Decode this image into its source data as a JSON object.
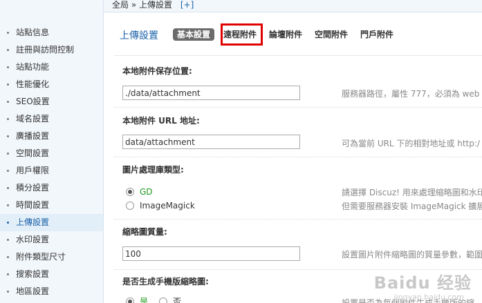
{
  "breadcrumb": {
    "home": "全局",
    "separator": "»",
    "current": "上傳設置",
    "add": "[+]"
  },
  "sidebar": {
    "items": [
      {
        "label": "站點信息"
      },
      {
        "label": "註冊與訪問控制"
      },
      {
        "label": "站點功能"
      },
      {
        "label": "性能優化"
      },
      {
        "label": "SEO設置"
      },
      {
        "label": "域名設置"
      },
      {
        "label": "廣播設置"
      },
      {
        "label": "空間設置"
      },
      {
        "label": "用戶權限"
      },
      {
        "label": "積分設置"
      },
      {
        "label": "時間設置"
      },
      {
        "label": "上傳設置",
        "active": true
      },
      {
        "label": "水印設置"
      },
      {
        "label": "附件類型尺寸"
      },
      {
        "label": "搜索設置"
      },
      {
        "label": "地區設置"
      }
    ]
  },
  "page": {
    "title": "上傳設置",
    "tabs": [
      "基本設置",
      "遠程附件",
      "論壇附件",
      "空間附件",
      "門戶附件"
    ],
    "active_tab": 0,
    "highlighted_tab": 1
  },
  "form": {
    "local_path": {
      "label": "本地附件保存位置:",
      "value": "./data/attachment",
      "tip": "服務器路徑，屬性 777，必須為 web"
    },
    "local_url": {
      "label": "本地附件 URL 地址:",
      "value": "data/attachment",
      "tip": "可為當前 URL 下的相對地址或 http:/"
    },
    "image_lib": {
      "label": "圖片處理庫類型:",
      "options": [
        "GD",
        "ImageMagick"
      ],
      "selected": 0,
      "tip1": "請選擇 Discuz! 用來處理縮略圖和水印",
      "tip2": "但需要服務器安裝 ImageMagick 擴展"
    },
    "thumb_quality": {
      "label": "縮略圖質量:",
      "value": "100",
      "tip": "設置圖片附件縮略圖的質量參數，範圍"
    },
    "mobile_thumb": {
      "label": "是否生成手機版縮略圖:",
      "options": [
        "是",
        "否"
      ],
      "selected": 0,
      "tip": "設置是否為每個附件生成手機版的縮"
    }
  },
  "watermark": {
    "brand": "Baidu 经验",
    "sub": "jingyan.baidu.com"
  }
}
